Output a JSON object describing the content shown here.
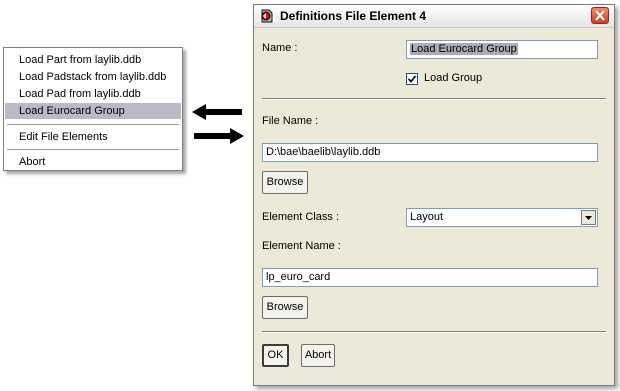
{
  "menu": {
    "items": [
      {
        "label": "Load Part from laylib.ddb"
      },
      {
        "label": "Load Padstack from laylib.ddb"
      },
      {
        "label": "Load Pad from laylib.ddb"
      },
      {
        "label": "Load Eurocard Group"
      },
      {
        "label": "Edit File Elements"
      },
      {
        "label": "Abort"
      }
    ],
    "selected_index": 3
  },
  "dialog": {
    "title": "Definitions File Element 4",
    "name_label": "Name :",
    "name_value": "Load Eurocard Group",
    "load_group_label": "Load Group",
    "load_group_checked": true,
    "file_name_label": "File Name :",
    "file_name_value": "D:\\bae\\baelib\\laylib.ddb",
    "browse_label": "Browse",
    "element_class_label": "Element Class :",
    "element_class_value": "Layout",
    "element_name_label": "Element Name :",
    "element_name_value": "lp_euro_card",
    "browse2_label": "Browse",
    "ok_label": "OK",
    "abort_label": "Abort"
  }
}
